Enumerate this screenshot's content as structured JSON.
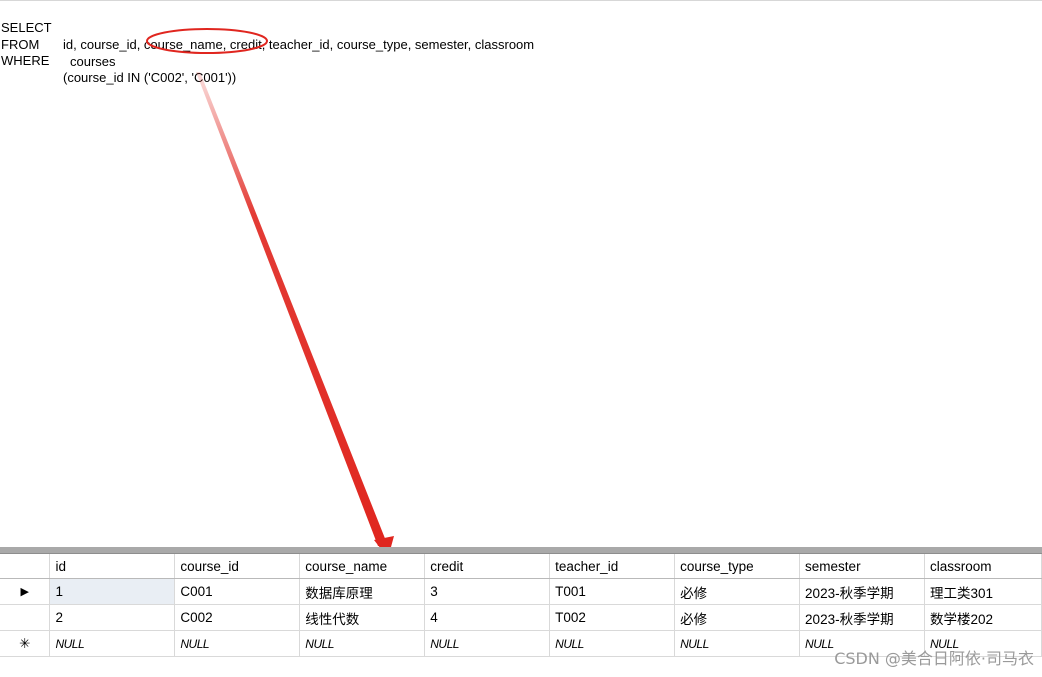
{
  "sql": {
    "select_kw": "SELECT",
    "select_body": "id, course_id, course_name, credit, teacher_id, course_type, semester, classroom",
    "from_kw": "FROM",
    "from_body": "courses",
    "where_kw": "WHERE",
    "where_body": "(course_id IN ('C002', 'C001'))"
  },
  "annotation": {
    "color": "#e0261f"
  },
  "results": {
    "columns": [
      "id",
      "course_id",
      "course_name",
      "credit",
      "teacher_id",
      "course_type",
      "semester",
      "classroom"
    ],
    "rows": [
      {
        "indicator": "▶",
        "cells": [
          "1",
          "C001",
          "数据库原理",
          "3",
          "T001",
          "必修",
          "2023-秋季学期",
          "理工类301"
        ]
      },
      {
        "indicator": "",
        "cells": [
          "2",
          "C002",
          "线性代数",
          "4",
          "T002",
          "必修",
          "2023-秋季学期",
          "数学楼202"
        ]
      },
      {
        "indicator": "✳",
        "cells": [
          "NULL",
          "NULL",
          "NULL",
          "NULL",
          "NULL",
          "NULL",
          "NULL",
          "NULL"
        ]
      }
    ]
  },
  "watermark": "CSDN @美合日阿依·司马衣"
}
